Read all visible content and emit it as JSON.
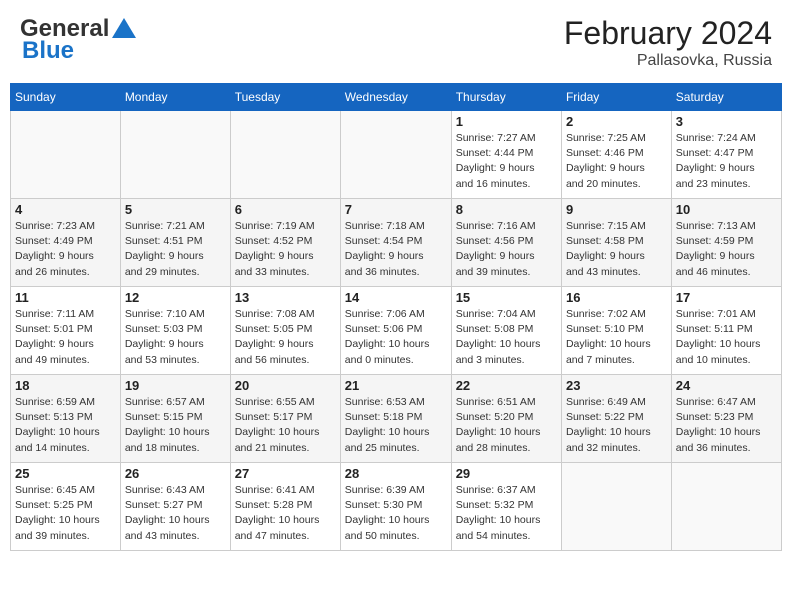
{
  "header": {
    "logo_line1": "General",
    "logo_line2": "Blue",
    "month": "February 2024",
    "location": "Pallasovka, Russia"
  },
  "weekdays": [
    "Sunday",
    "Monday",
    "Tuesday",
    "Wednesday",
    "Thursday",
    "Friday",
    "Saturday"
  ],
  "weeks": [
    [
      {
        "day": "",
        "info": ""
      },
      {
        "day": "",
        "info": ""
      },
      {
        "day": "",
        "info": ""
      },
      {
        "day": "",
        "info": ""
      },
      {
        "day": "1",
        "info": "Sunrise: 7:27 AM\nSunset: 4:44 PM\nDaylight: 9 hours\nand 16 minutes."
      },
      {
        "day": "2",
        "info": "Sunrise: 7:25 AM\nSunset: 4:46 PM\nDaylight: 9 hours\nand 20 minutes."
      },
      {
        "day": "3",
        "info": "Sunrise: 7:24 AM\nSunset: 4:47 PM\nDaylight: 9 hours\nand 23 minutes."
      }
    ],
    [
      {
        "day": "4",
        "info": "Sunrise: 7:23 AM\nSunset: 4:49 PM\nDaylight: 9 hours\nand 26 minutes."
      },
      {
        "day": "5",
        "info": "Sunrise: 7:21 AM\nSunset: 4:51 PM\nDaylight: 9 hours\nand 29 minutes."
      },
      {
        "day": "6",
        "info": "Sunrise: 7:19 AM\nSunset: 4:52 PM\nDaylight: 9 hours\nand 33 minutes."
      },
      {
        "day": "7",
        "info": "Sunrise: 7:18 AM\nSunset: 4:54 PM\nDaylight: 9 hours\nand 36 minutes."
      },
      {
        "day": "8",
        "info": "Sunrise: 7:16 AM\nSunset: 4:56 PM\nDaylight: 9 hours\nand 39 minutes."
      },
      {
        "day": "9",
        "info": "Sunrise: 7:15 AM\nSunset: 4:58 PM\nDaylight: 9 hours\nand 43 minutes."
      },
      {
        "day": "10",
        "info": "Sunrise: 7:13 AM\nSunset: 4:59 PM\nDaylight: 9 hours\nand 46 minutes."
      }
    ],
    [
      {
        "day": "11",
        "info": "Sunrise: 7:11 AM\nSunset: 5:01 PM\nDaylight: 9 hours\nand 49 minutes."
      },
      {
        "day": "12",
        "info": "Sunrise: 7:10 AM\nSunset: 5:03 PM\nDaylight: 9 hours\nand 53 minutes."
      },
      {
        "day": "13",
        "info": "Sunrise: 7:08 AM\nSunset: 5:05 PM\nDaylight: 9 hours\nand 56 minutes."
      },
      {
        "day": "14",
        "info": "Sunrise: 7:06 AM\nSunset: 5:06 PM\nDaylight: 10 hours\nand 0 minutes."
      },
      {
        "day": "15",
        "info": "Sunrise: 7:04 AM\nSunset: 5:08 PM\nDaylight: 10 hours\nand 3 minutes."
      },
      {
        "day": "16",
        "info": "Sunrise: 7:02 AM\nSunset: 5:10 PM\nDaylight: 10 hours\nand 7 minutes."
      },
      {
        "day": "17",
        "info": "Sunrise: 7:01 AM\nSunset: 5:11 PM\nDaylight: 10 hours\nand 10 minutes."
      }
    ],
    [
      {
        "day": "18",
        "info": "Sunrise: 6:59 AM\nSunset: 5:13 PM\nDaylight: 10 hours\nand 14 minutes."
      },
      {
        "day": "19",
        "info": "Sunrise: 6:57 AM\nSunset: 5:15 PM\nDaylight: 10 hours\nand 18 minutes."
      },
      {
        "day": "20",
        "info": "Sunrise: 6:55 AM\nSunset: 5:17 PM\nDaylight: 10 hours\nand 21 minutes."
      },
      {
        "day": "21",
        "info": "Sunrise: 6:53 AM\nSunset: 5:18 PM\nDaylight: 10 hours\nand 25 minutes."
      },
      {
        "day": "22",
        "info": "Sunrise: 6:51 AM\nSunset: 5:20 PM\nDaylight: 10 hours\nand 28 minutes."
      },
      {
        "day": "23",
        "info": "Sunrise: 6:49 AM\nSunset: 5:22 PM\nDaylight: 10 hours\nand 32 minutes."
      },
      {
        "day": "24",
        "info": "Sunrise: 6:47 AM\nSunset: 5:23 PM\nDaylight: 10 hours\nand 36 minutes."
      }
    ],
    [
      {
        "day": "25",
        "info": "Sunrise: 6:45 AM\nSunset: 5:25 PM\nDaylight: 10 hours\nand 39 minutes."
      },
      {
        "day": "26",
        "info": "Sunrise: 6:43 AM\nSunset: 5:27 PM\nDaylight: 10 hours\nand 43 minutes."
      },
      {
        "day": "27",
        "info": "Sunrise: 6:41 AM\nSunset: 5:28 PM\nDaylight: 10 hours\nand 47 minutes."
      },
      {
        "day": "28",
        "info": "Sunrise: 6:39 AM\nSunset: 5:30 PM\nDaylight: 10 hours\nand 50 minutes."
      },
      {
        "day": "29",
        "info": "Sunrise: 6:37 AM\nSunset: 5:32 PM\nDaylight: 10 hours\nand 54 minutes."
      },
      {
        "day": "",
        "info": ""
      },
      {
        "day": "",
        "info": ""
      }
    ]
  ]
}
